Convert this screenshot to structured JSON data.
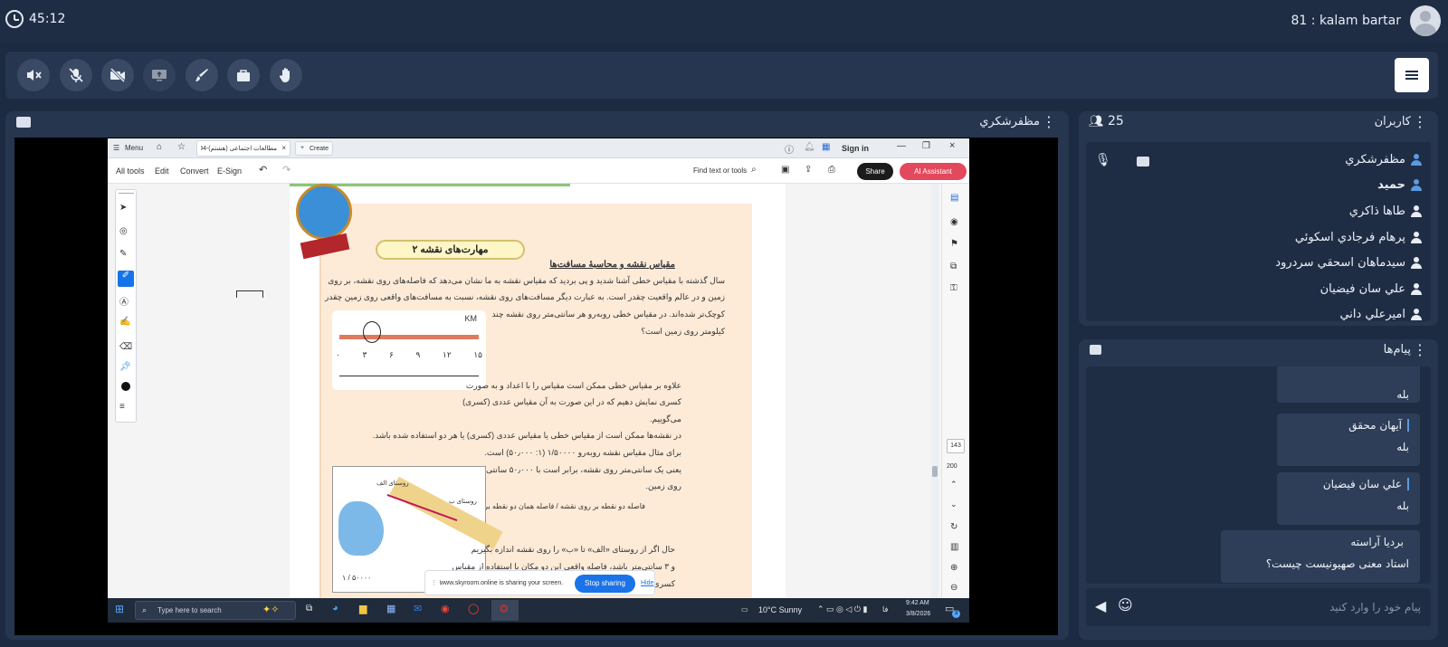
{
  "topbar": {
    "timer": "45:12",
    "user_label": "81 : kalam bartar"
  },
  "toolbar": {
    "buttons": [
      "speaker-muted",
      "mic-muted",
      "camera-off",
      "share-screen",
      "whiteboard-pen",
      "bag",
      "raise-hand"
    ]
  },
  "video_panel": {
    "presenter_name": "مظفرشكري"
  },
  "shared_screen": {
    "tab_menu": "Menu",
    "tab_title": "مطالعات اجتماعی (هشتم)-94...",
    "tab_create": "Create",
    "sign_in": "Sign in",
    "commands": [
      "All tools",
      "Edit",
      "Convert",
      "E-Sign"
    ],
    "find_text": "Find text or tools",
    "share": "Share",
    "ai_assistant": "AI Assistant",
    "page_banner": "مهارت‌های نقشه ۲",
    "heading": "مقیاس نقشه و محاسبهٔ مسافت‌ها",
    "line1": "سال گذشته با مقیاس خطی آشنا شدید و پی بردید که مقیاس نقشه به ما نشان می‌دهد که فاصله‌های روی نقشه، بر روی",
    "line2": "زمین و در عالم واقعیت چقدر است. به عبارت دیگر مسافت‌های روی نقشه، نسبت به مسافت‌های واقعی روی زمین چقدر",
    "line3": "کوچک‌تر شده‌اند. در مقیاس خطی روبه‌رو هر سانتی‌متر روی نقشه چند",
    "line4": "کیلومتر روی زمین است؟",
    "scale_unit": "KM",
    "scale_ticks": [
      "۰",
      "۳",
      "۶",
      "۹",
      "۱۲",
      "۱۵"
    ],
    "para2_1": "علاوه بر مقیاس خطی ممکن است مقیاس را با اعداد و به صورت",
    "para2_2": "کسری نمایش دهیم که در این صورت به آن مقیاس عددی (کسری)",
    "para2_3": "می‌گوییم.",
    "para3_1": "در نقشه‌ها ممکن است از مقیاس خطی یا مقیاس عددی (کسری) یا هر دو استفاده شده باشد.",
    "para3_2": "برای مثال مقیاس نقشه روبه‌رو   ۱/۵۰۰۰۰   (۱: ۵۰٫۰۰۰) است.",
    "para3_3": "یعنی یک سانتی‌متر روی نقشه، برابر است با ۵۰٫۰۰۰ سانتی‌متر",
    "para3_4": "روی زمین.",
    "formula": "فاصله دو نقطه بر روی نقشه / فاصله همان دو نقطه بر روی زمین = مقیاس",
    "map_label_a": "روستای الف",
    "map_label_b": "روستای ب",
    "map_scale": "۱ / ۵۰۰۰۰",
    "para4_1": "حال اگر از روستای «الف» تا «ب» را روی نقشه اندازه بگیریم",
    "para4_2": "و ۳ سانتی‌متر باشد، فاصله واقعی این دو مکان با استفاده از مقیاس",
    "para4_3": "کسری به صورت",
    "zoom_value": "143",
    "page_count": "200",
    "sharing_text": "www.skyroom.online is sharing your screen.",
    "stop_sharing": "Stop sharing",
    "hide": "Hide",
    "search_placeholder": "Type here to search",
    "weather": "10°C  Sunny",
    "time": "9:42 AM",
    "date": "3/8/2026",
    "lang": "فا",
    "notif_count": "3"
  },
  "users_panel": {
    "title": "كاربران",
    "count": "25",
    "users": [
      {
        "name": "مظفرشكري",
        "highlight": true,
        "bold": false
      },
      {
        "name": "حميد",
        "highlight": true,
        "bold": true
      },
      {
        "name": "طاها ذاكري",
        "highlight": false,
        "bold": false
      },
      {
        "name": "پرهام فرجادي اسكوئي",
        "highlight": false,
        "bold": false
      },
      {
        "name": "سيدماهان اسحقي سردرود",
        "highlight": false,
        "bold": false
      },
      {
        "name": "علي سان فيضيان",
        "highlight": false,
        "bold": false
      },
      {
        "name": "اميرعلي داني",
        "highlight": false,
        "bold": false
      }
    ]
  },
  "messages_panel": {
    "title": "پيام‌ها",
    "messages": [
      {
        "name": "",
        "text": "بله"
      },
      {
        "name": "آيهان محقق",
        "text": "بله"
      },
      {
        "name": "علي سان فيضيان",
        "text": "بله"
      },
      {
        "name": "برديا آراسته",
        "text": "استاد معنی صهیونیست چیست؟"
      }
    ],
    "input_placeholder": "پيام خود را وارد كنيد"
  },
  "colors": {
    "accent": "#5a9ae0",
    "panel": "#26364f",
    "background": "#1c2a42",
    "stop_sharing": "#1a73e8"
  }
}
